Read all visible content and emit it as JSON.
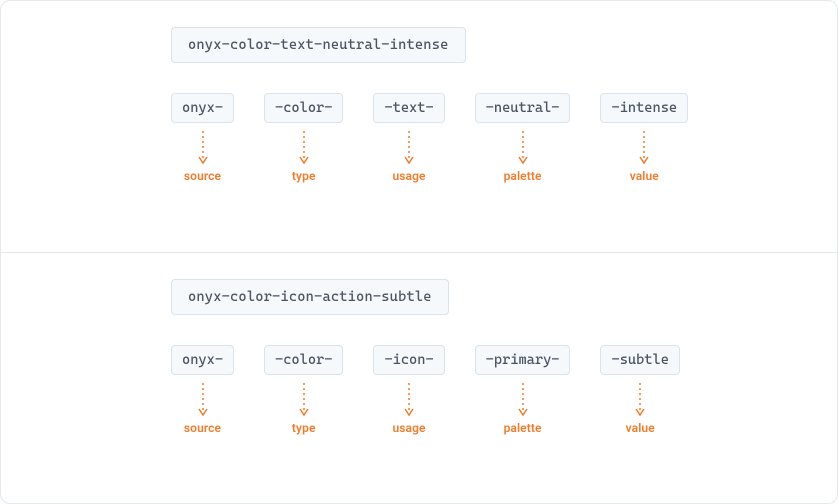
{
  "accent": "#f07b2a",
  "examples": [
    {
      "full": "onyx-color-text-neutral-intense",
      "parts": [
        {
          "chip": "onyx-",
          "label": "source"
        },
        {
          "chip": "-color-",
          "label": "type"
        },
        {
          "chip": "-text-",
          "label": "usage"
        },
        {
          "chip": "-neutral-",
          "label": "palette"
        },
        {
          "chip": "-intense",
          "label": "value"
        }
      ]
    },
    {
      "full": "onyx-color-icon-action-subtle",
      "parts": [
        {
          "chip": "onyx-",
          "label": "source"
        },
        {
          "chip": "-color-",
          "label": "type"
        },
        {
          "chip": "-icon-",
          "label": "usage"
        },
        {
          "chip": "-primary-",
          "label": "palette"
        },
        {
          "chip": "-subtle",
          "label": "value"
        }
      ]
    }
  ]
}
